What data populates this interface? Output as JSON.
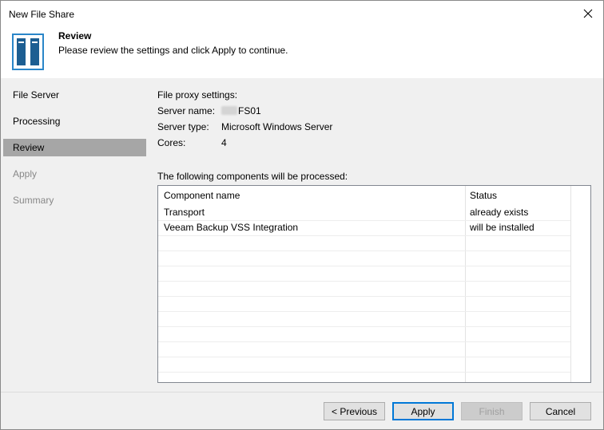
{
  "window": {
    "title": "New File Share",
    "close_glyph": "✕"
  },
  "header": {
    "title": "Review",
    "subtitle": "Please review the settings and click Apply to continue.",
    "icon": "file-share-server-icon"
  },
  "nav": {
    "items": [
      {
        "label": "File Server",
        "state": "normal"
      },
      {
        "label": "Processing",
        "state": "normal"
      },
      {
        "label": "Review",
        "state": "active"
      },
      {
        "label": "Apply",
        "state": "disabled"
      },
      {
        "label": "Summary",
        "state": "disabled"
      }
    ]
  },
  "settings": {
    "section_title": "File proxy settings:",
    "server_name_label": "Server name:",
    "server_name_value": "FS01",
    "server_type_label": "Server type:",
    "server_type_value": "Microsoft Windows Server",
    "cores_label": "Cores:",
    "cores_value": "4"
  },
  "components": {
    "title": "The following components will be processed:",
    "columns": [
      "Component name",
      "Status"
    ],
    "rows": [
      [
        "Transport",
        "already exists"
      ],
      [
        "Veeam Backup VSS Integration",
        "will be installed"
      ]
    ]
  },
  "buttons": {
    "previous": "< Previous",
    "apply": "Apply",
    "finish": "Finish",
    "cancel": "Cancel"
  }
}
